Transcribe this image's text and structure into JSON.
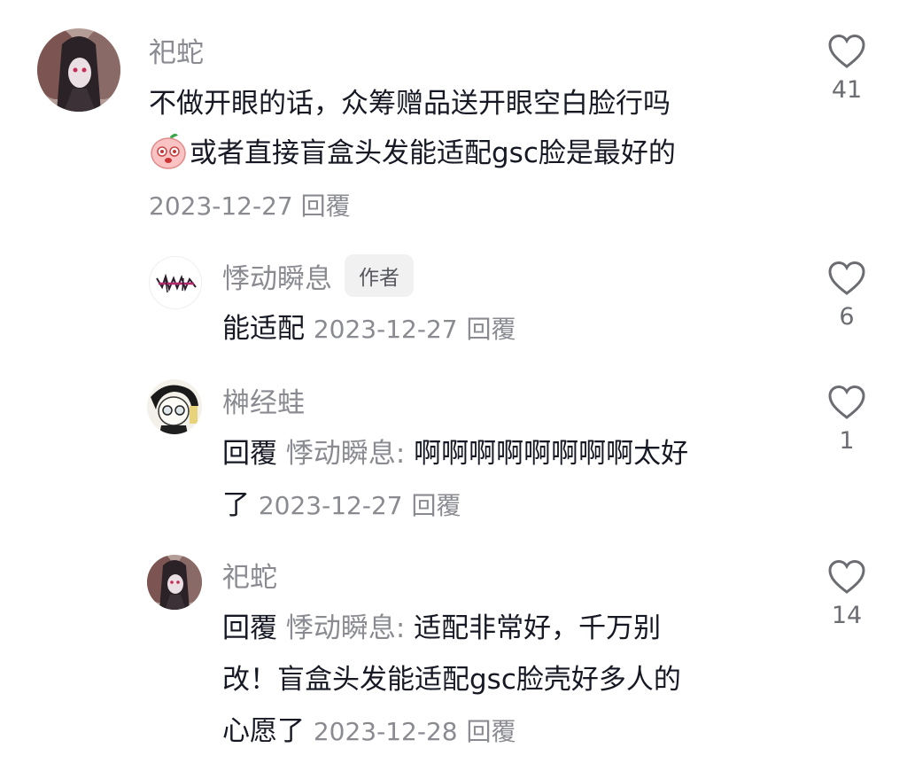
{
  "comments": [
    {
      "username": "祀蛇",
      "text_line1": "不做开眼的话，众筹赠品送开眼空白脸行吗",
      "text_line2": "或者直接盲盒头发能适配gsc脸是最好的",
      "emoji_icon": "peach-face-emoji",
      "date": "2023-12-27",
      "reply_label": "回覆",
      "likes": "41"
    },
    {
      "username": "悸动瞬息",
      "badge": "作者",
      "text": "能适配",
      "date": "2023-12-27",
      "reply_label": "回覆",
      "likes": "6"
    },
    {
      "username": "榊经蛙",
      "reply_prefix": "回覆",
      "reply_target": "悸动瞬息:",
      "text_line1": "啊啊啊啊啊啊啊啊太好",
      "text_line2": "了",
      "date": "2023-12-27",
      "reply_label": "回覆",
      "likes": "1"
    },
    {
      "username": "祀蛇",
      "reply_prefix": "回覆",
      "reply_target": "悸动瞬息:",
      "text_line1": "适配非常好，千万别",
      "text_line2": "改！盲盒头发能适配gsc脸壳好多人的",
      "text_line3": "心愿了",
      "date": "2023-12-28",
      "reply_label": "回覆",
      "likes": "14"
    }
  ],
  "icons": {
    "like": "heart-outline-icon"
  },
  "colors": {
    "text": "#161823",
    "secondary": "#8a8b91",
    "badge_bg": "#f1f1f2",
    "like_icon": "#6c6d72"
  }
}
